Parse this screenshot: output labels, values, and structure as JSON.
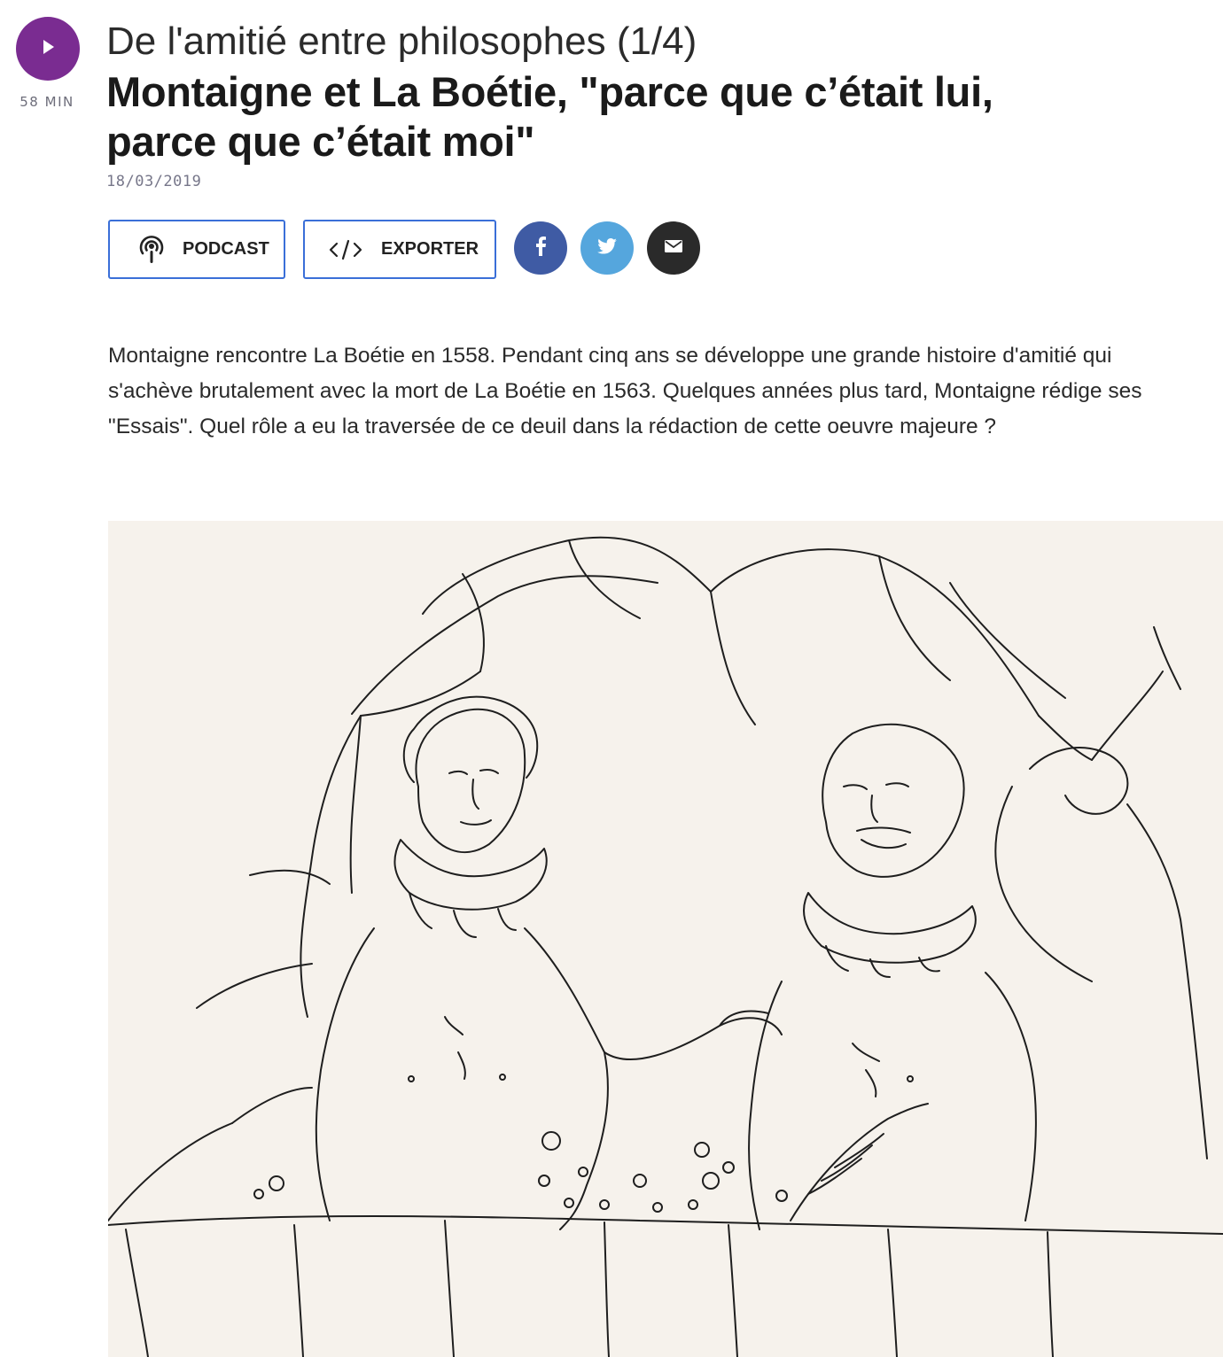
{
  "player": {
    "duration": "58 MIN"
  },
  "header": {
    "series_title": "De l'amitié entre philosophes (1/4)",
    "episode_title": "Montaigne et La Boétie, \"parce que c’était lui, parce que c’était moi\"",
    "date": "18/03/2019"
  },
  "actions": {
    "podcast_label": "PODCAST",
    "export_label": "EXPORTER",
    "share": [
      {
        "name": "facebook",
        "icon": "facebook-icon",
        "color": "#3f5ba4"
      },
      {
        "name": "twitter",
        "icon": "twitter-icon",
        "color": "#55a6dd"
      },
      {
        "name": "email",
        "icon": "mail-icon",
        "color": "#2a2a2a"
      }
    ]
  },
  "abstract": "Montaigne rencontre La Boétie en 1558. Pendant cinq ans se développe une grande histoire d'amitié qui s'achève brutalement avec la mort de La Boétie en 1563. Quelques années plus tard, Montaigne rédige ses \"Essais\". Quel rôle a eu la traversée de ce deuil dans la rédaction de cette oeuvre majeure ?",
  "colors": {
    "accent": "#7a2c91",
    "button_border": "#3a6fd8",
    "illustration_bg": "#f6f2ec"
  }
}
